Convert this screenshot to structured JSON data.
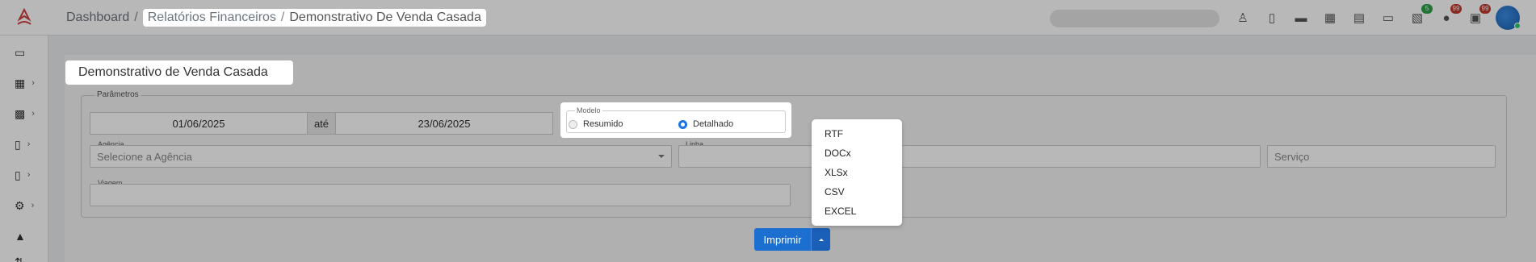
{
  "breadcrumb": {
    "items": [
      "Dashboard",
      "Relatórios Financeiros",
      "Demonstrativo De Venda Casada"
    ],
    "separator": "/"
  },
  "topbar": {
    "badges": {
      "cart": "5",
      "notifications": "99",
      "tasks": "99"
    }
  },
  "page": {
    "title": "Demonstrativo de Venda Casada"
  },
  "params": {
    "legend": "Parâmetros",
    "date_from": "01/06/2025",
    "date_sep": "até",
    "date_to": "23/06/2025",
    "modelo_legend": "Modelo",
    "radio_resumido": "Resumido",
    "radio_detalhado": "Detalhado",
    "selected_model": "Detalhado",
    "agencia_label": "Agência",
    "agencia_placeholder": "Selecione a Agência",
    "linha_label": "Linha",
    "servico_placeholder": "Serviço",
    "viagem_label": "Viagem"
  },
  "actions": {
    "print_label": "Imprimir"
  },
  "export_menu": {
    "options": [
      "RTF",
      "DOCx",
      "XLSx",
      "CSV",
      "EXCEL"
    ]
  },
  "colors": {
    "primary": "#1a6fd0",
    "logo": "#d23f3f",
    "badge_green": "#2e9e4a",
    "badge_red": "#c0392b"
  }
}
